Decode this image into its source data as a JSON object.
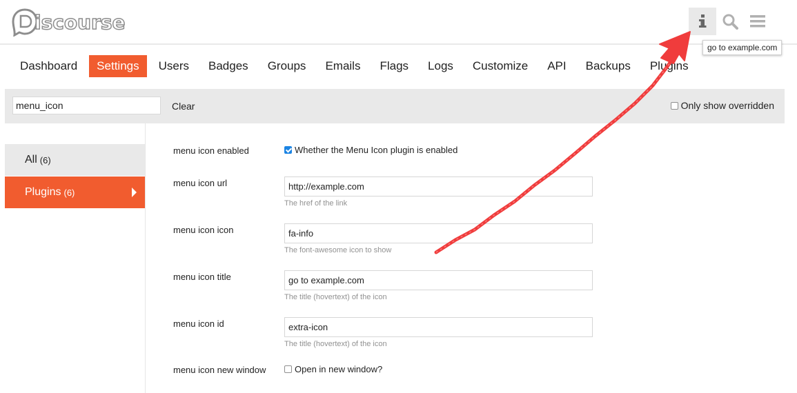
{
  "header": {
    "logo_text": "iscourse",
    "tooltip": "go to example.com",
    "icons": [
      "info-icon",
      "search-icon",
      "hamburger-menu-icon"
    ]
  },
  "nav": {
    "tabs": [
      {
        "label": "Dashboard",
        "active": false
      },
      {
        "label": "Settings",
        "active": true
      },
      {
        "label": "Users",
        "active": false
      },
      {
        "label": "Badges",
        "active": false
      },
      {
        "label": "Groups",
        "active": false
      },
      {
        "label": "Emails",
        "active": false
      },
      {
        "label": "Flags",
        "active": false
      },
      {
        "label": "Logs",
        "active": false
      },
      {
        "label": "Customize",
        "active": false
      },
      {
        "label": "API",
        "active": false
      },
      {
        "label": "Backups",
        "active": false
      },
      {
        "label": "Plugins",
        "active": false
      }
    ]
  },
  "filter": {
    "value": "menu_icon",
    "clear_label": "Clear",
    "only_overridden_label": "Only show overridden",
    "only_overridden_checked": false
  },
  "sidebar": {
    "items": [
      {
        "label": "All",
        "count": "(6)",
        "active": false
      },
      {
        "label": "Plugins",
        "count": "(6)",
        "active": true
      }
    ]
  },
  "settings": [
    {
      "label": "menu icon enabled",
      "type": "checkbox",
      "checked": true,
      "check_label": "Whether the Menu Icon plugin is enabled"
    },
    {
      "label": "menu icon url",
      "type": "text",
      "value": "http://example.com",
      "description": "The href of the link"
    },
    {
      "label": "menu icon icon",
      "type": "text",
      "value": "fa-info",
      "description": "The font-awesome icon to show"
    },
    {
      "label": "menu icon title",
      "type": "text",
      "value": "go to example.com",
      "description": "The title (hovertext) of the icon"
    },
    {
      "label": "menu icon id",
      "type": "text",
      "value": "extra-icon",
      "description": "The title (hovertext) of the icon"
    },
    {
      "label": "menu icon new window",
      "type": "checkbox",
      "checked": false,
      "check_label": "Open in new window?"
    }
  ],
  "colors": {
    "accent": "#f15c2f",
    "annotation_arrow": "#f03c3c",
    "checkbox_checked": "#1c84e3"
  }
}
